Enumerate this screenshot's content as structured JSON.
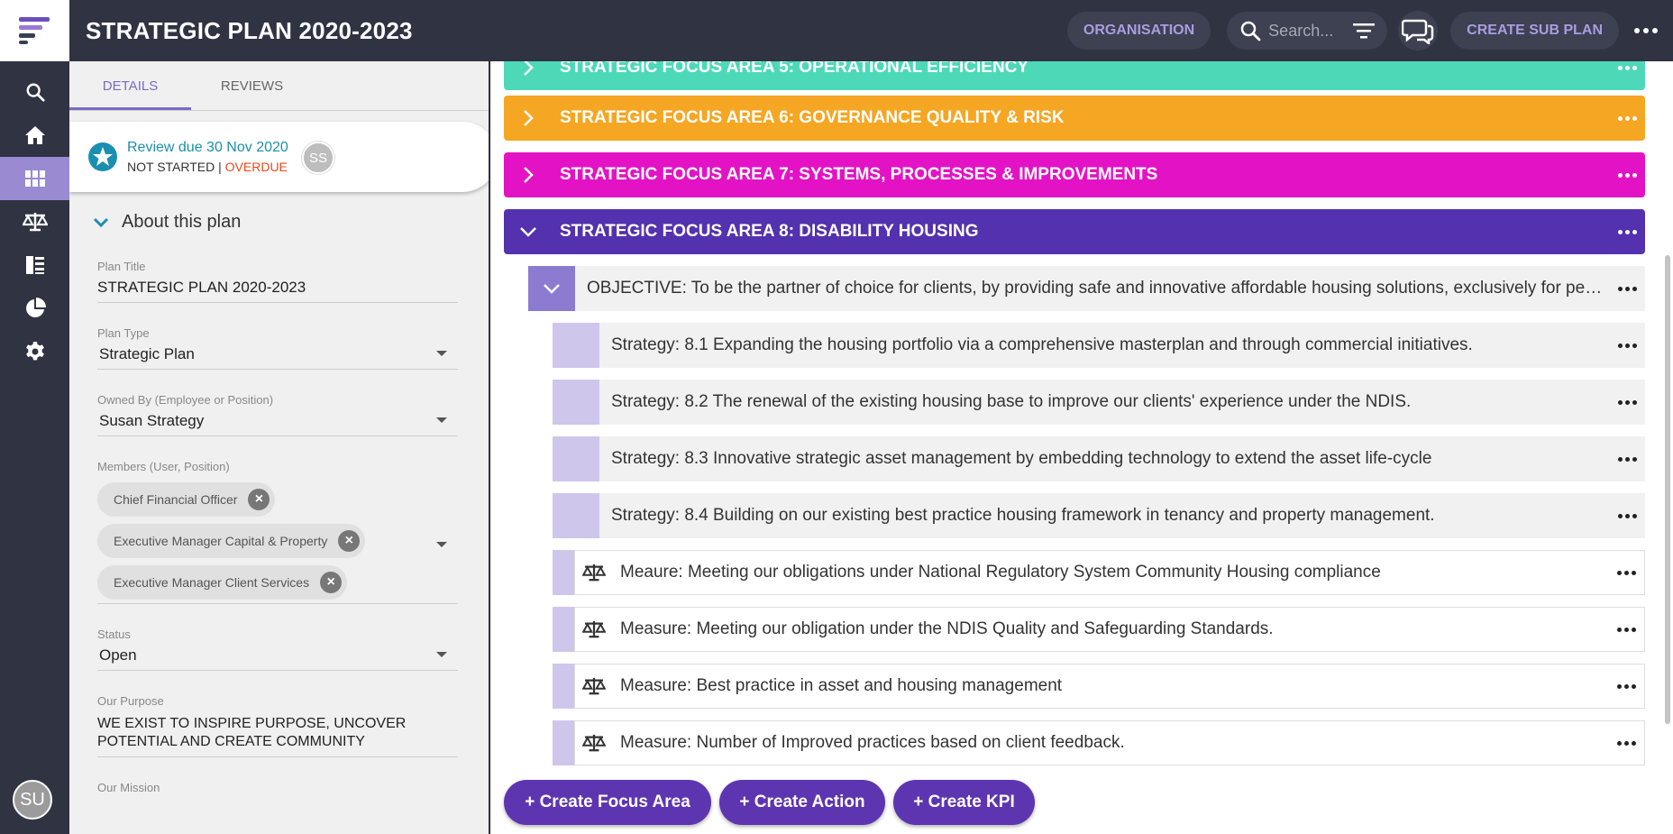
{
  "header": {
    "title": "STRATEGIC PLAN 2020-2023",
    "organisation_label": "ORGANISATION",
    "search_placeholder": "Search...",
    "create_sub_plan_label": "CREATE SUB PLAN"
  },
  "nav": {
    "items": [
      "search-icon",
      "home-icon",
      "plans-grid-icon",
      "scales-icon",
      "document-icon",
      "pie-chart-icon",
      "gear-icon"
    ],
    "active": "plans-grid-icon",
    "user_initials": "SU"
  },
  "details": {
    "tabs": [
      {
        "label": "DETAILS",
        "active": true
      },
      {
        "label": "REVIEWS",
        "active": false
      }
    ],
    "review": {
      "due": "Review due 30 Nov 2020",
      "status": "NOT STARTED",
      "separator": " | ",
      "overdue": "OVERDUE",
      "assignee_initials": "SS"
    },
    "section_title": "About this plan",
    "fields": {
      "plan_title": {
        "label": "Plan Title",
        "value": "STRATEGIC PLAN 2020-2023"
      },
      "plan_type": {
        "label": "Plan Type",
        "value": "Strategic Plan"
      },
      "owned_by": {
        "label": "Owned By (Employee or Position)",
        "value": "Susan Strategy"
      },
      "members": {
        "label": "Members (User, Position)",
        "chips": [
          "Chief Financial Officer",
          "Executive Manager Capital & Property",
          "Executive Manager Client Services"
        ]
      },
      "status": {
        "label": "Status",
        "value": "Open"
      },
      "purpose": {
        "label": "Our Purpose",
        "value": "WE EXIST TO INSPIRE PURPOSE, UNCOVER POTENTIAL AND CREATE COMMUNITY"
      },
      "mission": {
        "label": "Our Mission"
      }
    }
  },
  "main": {
    "focus_areas": [
      {
        "label": "STRATEGIC FOCUS AREA 5: OPERATIONAL EFFICIENCY",
        "color": "#4dd9b8",
        "expanded": false
      },
      {
        "label": "STRATEGIC FOCUS AREA 6: GOVERNANCE QUALITY & RISK",
        "color": "#f5a623",
        "expanded": false
      },
      {
        "label": "STRATEGIC FOCUS AREA 7: SYSTEMS, PROCESSES & IMPROVEMENTS",
        "color": "#e313c5",
        "expanded": false
      },
      {
        "label": "STRATEGIC FOCUS AREA 8: DISABILITY HOUSING",
        "color": "#5431ae",
        "expanded": true
      }
    ],
    "objective": "OBJECTIVE: To be the partner of choice for clients, by providing safe and innovative affordable housing solutions, exclusively for people with disability.",
    "strategies": [
      "Strategy: 8.1 Expanding the housing portfolio via a comprehensive masterplan and through commercial initiatives.",
      "Strategy: 8.2 The renewal of the existing housing base to improve our clients' experience under the NDIS.",
      "Strategy: 8.3 Innovative strategic asset management by embedding technology to extend the asset life-cycle",
      "Strategy: 8.4 Building on our existing best practice housing framework in tenancy and property management."
    ],
    "measures": [
      "Meaure: Meeting our obligations under National Regulatory System Community Housing compliance",
      "Measure: Meeting our obligation under the NDIS Quality and Safeguarding Standards.",
      "Measure: Best practice in asset and housing management",
      "Measure: Number of Improved practices based on client feedback."
    ],
    "buttons": {
      "create_focus_area": "+ Create Focus Area",
      "create_action": "+ Create Action",
      "create_kpi": "+ Create KPI"
    }
  }
}
